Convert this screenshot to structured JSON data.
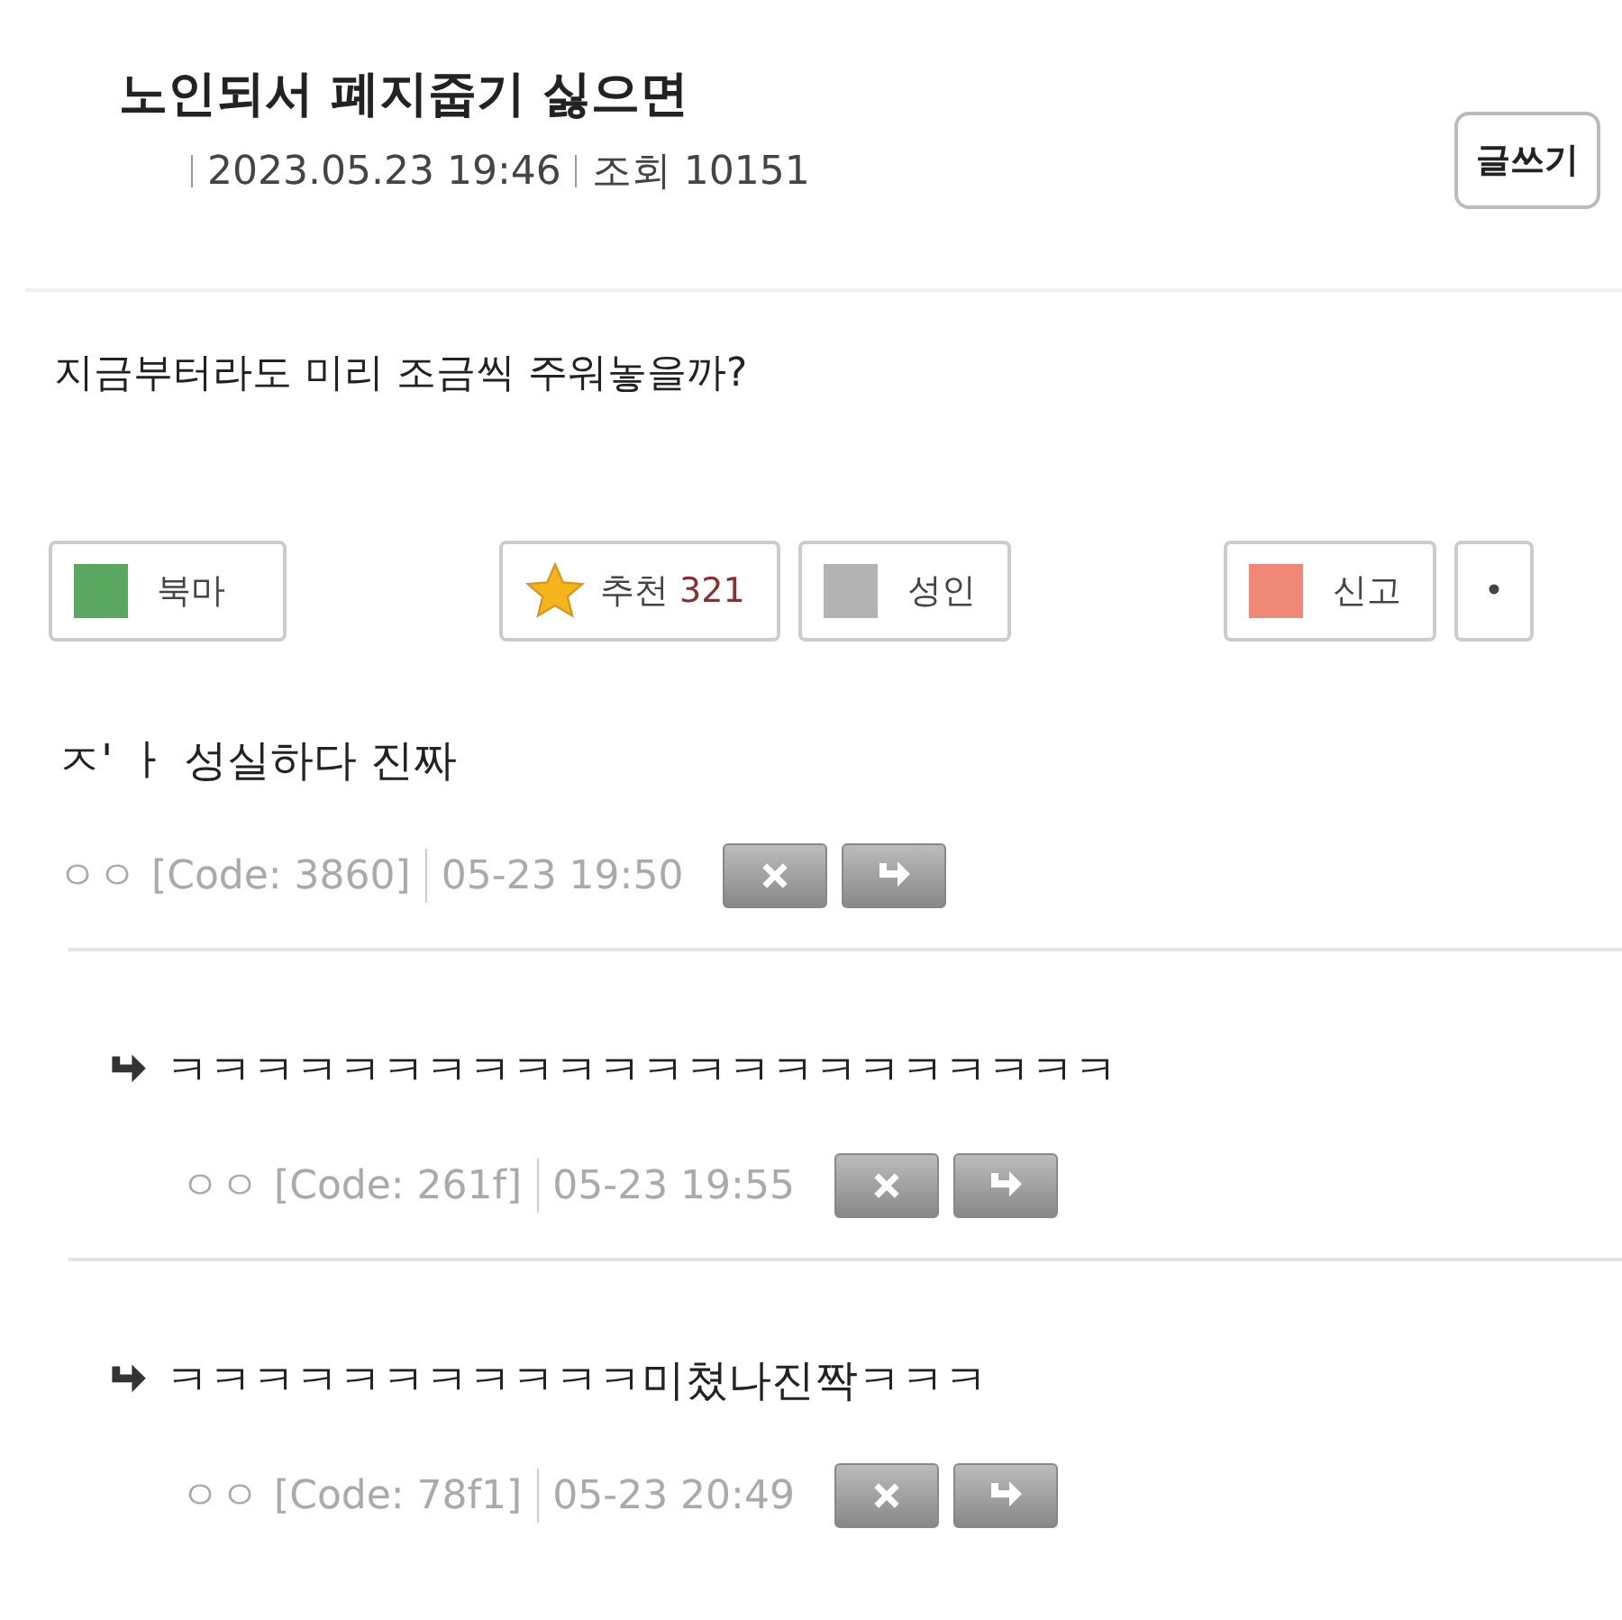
{
  "post": {
    "title": "노인되서 폐지줍기 싫으면",
    "date": "2023.05.23 19:46",
    "views_label": "조회",
    "views": "10151",
    "write_button": "글쓰기",
    "body": "지금부터라도 미리 조금씩 주워놓을까?"
  },
  "actions": [
    {
      "kind": "square",
      "label": "북마",
      "color": "#5aa85f"
    },
    {
      "kind": "star",
      "label": "추천",
      "count": "321"
    },
    {
      "kind": "square",
      "label": "성인",
      "color": "#b3b3b3"
    },
    {
      "kind": "square",
      "label": "신고",
      "color": "#f08878"
    },
    {
      "kind": "dot",
      "label": "•"
    }
  ],
  "comments": [
    {
      "reply": false,
      "text": "ㅈ' ㅏ 성실하다 진짜",
      "author": "ㅇㅇ",
      "code": "[Code: 3860]",
      "time": "05-23 19:50"
    },
    {
      "reply": true,
      "text": "ㅋㅋㅋㅋㅋㅋㅋㅋㅋㅋㅋㅋㅋㅋㅋㅋㅋㅋㅋㅋㅋㅋ",
      "author": "ㅇㅇ",
      "code": "[Code: 261f]",
      "time": "05-23 19:55"
    },
    {
      "reply": true,
      "text": "ㅋㅋㅋㅋㅋㅋㅋㅋㅋㅋㅋ미쳤나진짝ㅋㅋㅋ",
      "author": "ㅇㅇ",
      "code": "[Code: 78f1]",
      "time": "05-23 20:49"
    }
  ]
}
